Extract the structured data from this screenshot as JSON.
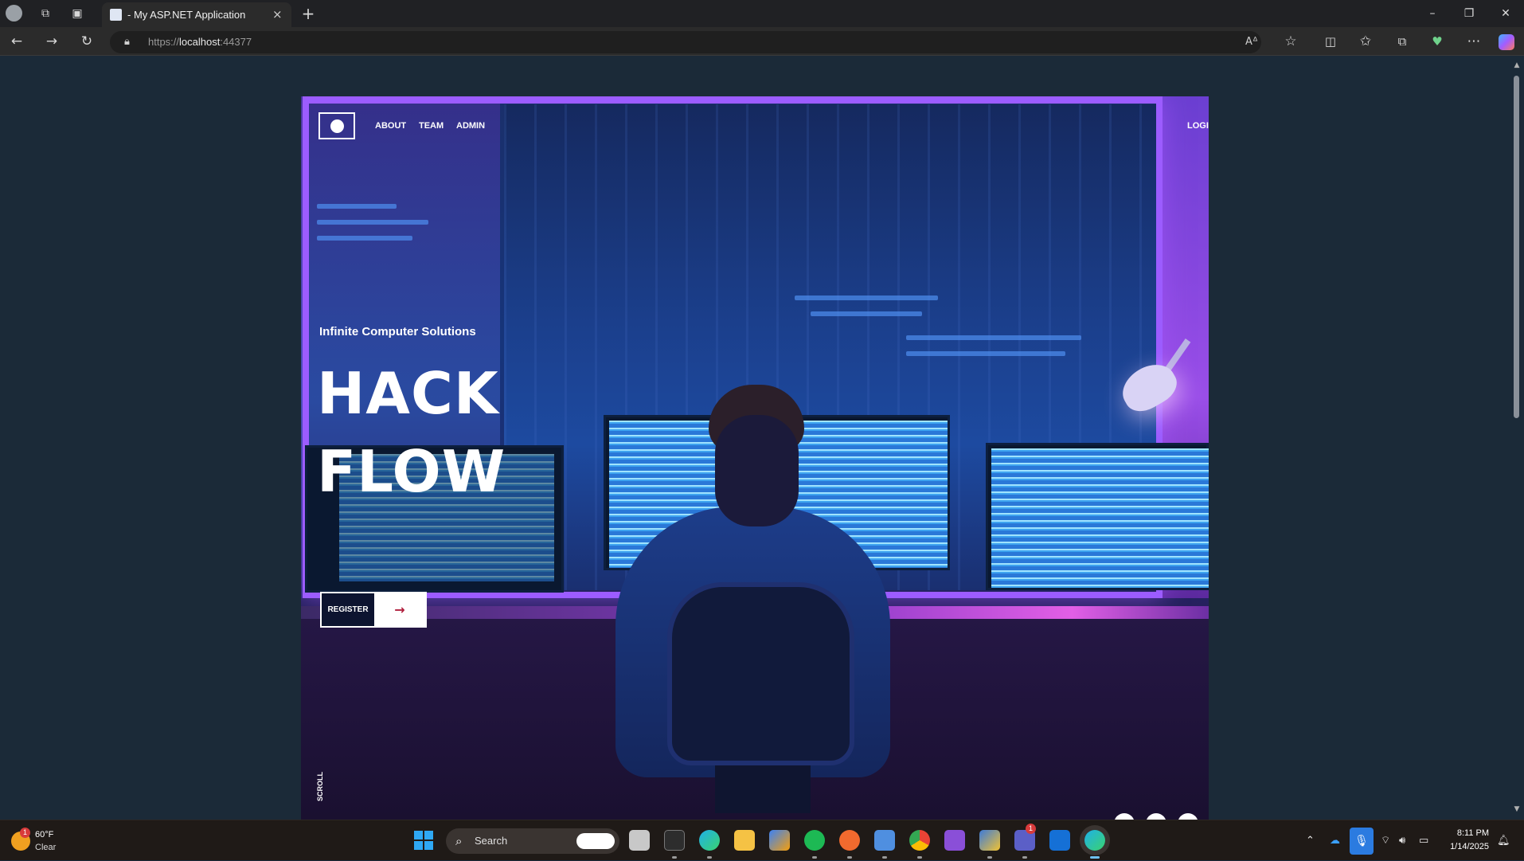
{
  "browser": {
    "tab_title": "- My ASP.NET Application",
    "tab_close": "×",
    "new_tab": "+",
    "url_scheme": "https://",
    "url_host": "localhost",
    "url_port": ":44377",
    "window_controls": {
      "minimize": "–",
      "restore": "❐",
      "close": "✕"
    },
    "toolbar_icons": [
      "back-icon",
      "forward-icon",
      "refresh-icon",
      "read-aloud-icon",
      "favorite-icon",
      "split-screen-icon",
      "favorites-icon",
      "collections-icon",
      "browser-essentials-icon",
      "more-icon",
      "copilot-icon"
    ]
  },
  "site": {
    "nav": {
      "about": "ABOUT",
      "team": "TEAM",
      "admin": "ADMIN",
      "login": "LOGIN"
    },
    "tagline": "Infinite Computer Solutions",
    "headline_1": "HACK",
    "headline_2": "FLOW",
    "register_label": "REGISTER",
    "register_arrow": "→",
    "scroll_label": "SCROLL"
  },
  "taskbar": {
    "weather_temp": "60°F",
    "weather_cond": "Clear",
    "weather_badge": "1",
    "search_placeholder": "Search",
    "teams_badge": "1",
    "clock_time": "8:11 PM",
    "clock_date": "1/14/2025",
    "apps": [
      "task-view",
      "terminal",
      "edge",
      "file-explorer",
      "store",
      "spotify",
      "app-orange",
      "notepad",
      "chrome",
      "visual-studio",
      "sticky-app",
      "teams",
      "mail",
      "edge-active"
    ]
  },
  "colors": {
    "page_bg": "#1b2a38",
    "accent_purple": "#9c5cff",
    "register_arrow": "#b01e3c"
  }
}
